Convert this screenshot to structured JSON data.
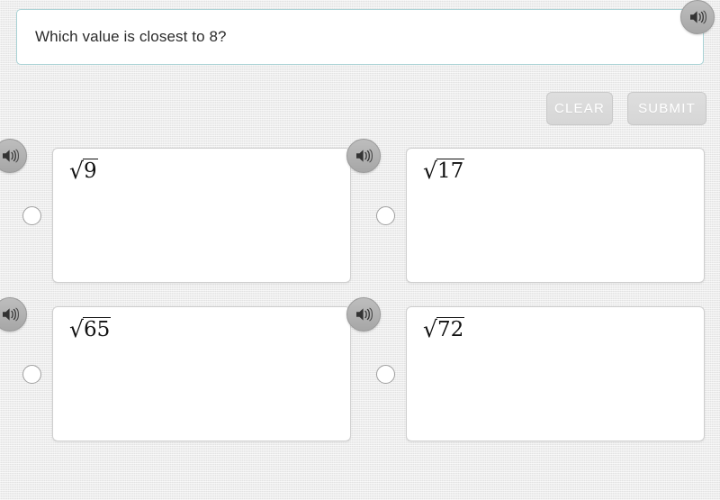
{
  "question": {
    "text": "Which value is closest to 8?",
    "speaker_icon": "speaker-icon"
  },
  "toolbar": {
    "clear_label": "CLEAR",
    "submit_label": "SUBMIT"
  },
  "answers": [
    {
      "radical_sign": "√",
      "radicand": "9",
      "selected": false,
      "speaker_icon": "speaker-icon"
    },
    {
      "radical_sign": "√",
      "radicand": "17",
      "selected": false,
      "speaker_icon": "speaker-icon"
    },
    {
      "radical_sign": "√",
      "radicand": "65",
      "selected": false,
      "speaker_icon": "speaker-icon"
    },
    {
      "radical_sign": "√",
      "radicand": "72",
      "selected": false,
      "speaker_icon": "speaker-icon"
    }
  ],
  "colors": {
    "page_background": "#e9e9e9",
    "question_border": "#a9d2d5",
    "card_border": "#cfcfcf",
    "button_face": "#d8d8d8",
    "button_text": "#ffffff",
    "speaker_fill": "#b2b2b2",
    "text": "#2b2b2b"
  }
}
